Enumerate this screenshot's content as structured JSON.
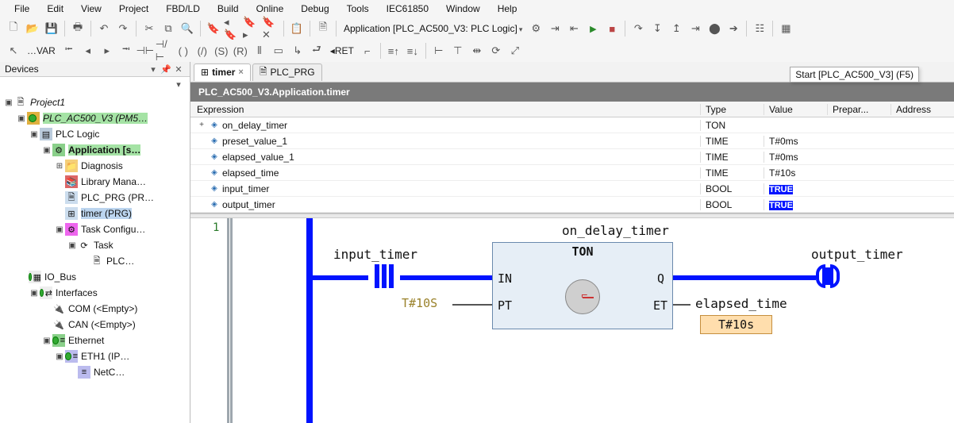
{
  "menu": [
    "File",
    "Edit",
    "View",
    "Project",
    "FBD/LD",
    "Build",
    "Online",
    "Debug",
    "Tools",
    "IEC61850",
    "Window",
    "Help"
  ],
  "toolbar_combo": "Application [PLC_AC500_V3: PLC Logic]",
  "start_tooltip": "Start [PLC_AC500_V3] (F5)",
  "devices_panel": {
    "title": "Devices"
  },
  "tree": {
    "project": "Project1",
    "plc": "PLC_AC500_V3 (PM5…",
    "logic": "PLC Logic",
    "app": "Application [s…",
    "diag": "Diagnosis",
    "lib": "Library Mana…",
    "plcprg": "PLC_PRG (PR…",
    "timer": "timer (PRG)",
    "taskcfg": "Task Configu…",
    "task": "Task",
    "plcleaf": "PLC…",
    "iobus": "IO_Bus",
    "interfaces": "Interfaces",
    "com": "COM (<Empty>)",
    "can": "CAN (<Empty>)",
    "ethernet": "Ethernet",
    "eth1": "ETH1 (IP…",
    "netc": "NetC…"
  },
  "tabs": {
    "timer": "timer",
    "plcprg": "PLC_PRG"
  },
  "path_bar": "PLC_AC500_V3.Application.timer",
  "var_head": {
    "exp": "Expression",
    "type": "Type",
    "value": "Value",
    "prep": "Prepar...",
    "addr": "Address"
  },
  "vars": [
    {
      "exp": "on_delay_timer",
      "type": "TON",
      "value": "",
      "twisty": "+"
    },
    {
      "exp": "preset_value_1",
      "type": "TIME",
      "value": "T#0ms"
    },
    {
      "exp": "elapsed_value_1",
      "type": "TIME",
      "value": "T#0ms"
    },
    {
      "exp": "elapsed_time",
      "type": "TIME",
      "value": "T#10s"
    },
    {
      "exp": "input_timer",
      "type": "BOOL",
      "value": "TRUE",
      "bool": true
    },
    {
      "exp": "output_timer",
      "type": "BOOL",
      "value": "TRUE",
      "bool": true
    }
  ],
  "fbd": {
    "rung": "1",
    "block_name": "on_delay_timer",
    "input_label": "input_timer",
    "output_label": "output_timer",
    "ton_title": "TON",
    "port_in": "IN",
    "port_pt": "PT",
    "port_q": "Q",
    "port_et": "ET",
    "pt_literal": "T#10S",
    "et_name": "elapsed_time",
    "et_value": "T#10s"
  }
}
